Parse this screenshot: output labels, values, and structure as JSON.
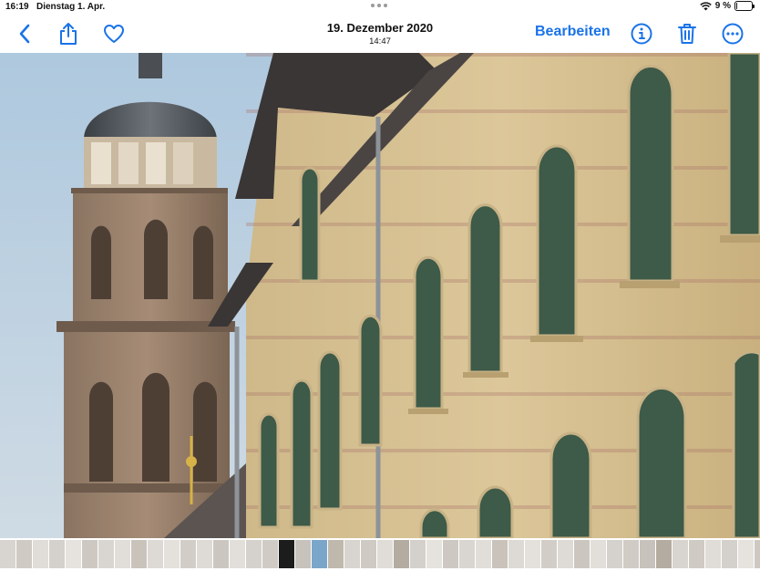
{
  "status_bar": {
    "time": "16:19",
    "date": "Dienstag 1. Apr.",
    "battery": "9 %",
    "battery_level": 0.09
  },
  "toolbar": {
    "title_date": "19. Dezember 2020",
    "title_time": "14:47",
    "edit_label": "Bearbeiten"
  },
  "icons": {
    "back": "chevron-left-icon",
    "share": "share-icon",
    "favorite": "heart-icon",
    "info": "info-icon",
    "delete": "trash-icon",
    "more": "ellipsis-circle-icon"
  },
  "colors": {
    "accent": "#1a73e8",
    "sky": "#b8cfe0",
    "brick": "#d9c48f"
  },
  "filmstrip": {
    "thumbs": [
      "#d8d4cf",
      "#cfcac4",
      "#e0ddd9",
      "#d4d0cb",
      "#e6e3df",
      "#cdc8c2",
      "#d9d5d0",
      "#e1deda",
      "#c9c3bc",
      "#ddd9d4",
      "#e4e0dc",
      "#d2cdc7",
      "#dedad5",
      "#cbc6bf",
      "#e2dfdb",
      "#d5d1cc",
      "#d0cbc5",
      "#1c1c1c",
      "#c7c2bb",
      "#7aa6c9",
      "#bfb8ad",
      "#d8d4cf",
      "#cfcac4",
      "#e0ddd9",
      "#b4aca1",
      "#d4d0cb",
      "#e6e3df",
      "#cdc8c2",
      "#d9d5d0",
      "#e1deda",
      "#c9c3bc",
      "#ddd9d4",
      "#e4e0dc",
      "#d2cdc7",
      "#dedad5",
      "#cbc6bf",
      "#e2dfdb",
      "#d5d1cc",
      "#d0cbc5",
      "#c7c2bb",
      "#b4aca1",
      "#d8d4cf",
      "#cfcac4",
      "#e0ddd9",
      "#d4d0cb",
      "#e6e3df",
      "#cdc8c2",
      "#d9d5d0",
      "#e1deda",
      "#c9c3bc",
      "#ddd9d4",
      "#e4e0dc",
      "#d2cdc7",
      "#dedad5",
      "#cbc6bf",
      "#e2dfdb",
      "#d5d1cc",
      "#d0cbc5",
      "#c7c2bb",
      "#b4aca1",
      "#d8d4cf",
      "#cfcac4",
      "#e0ddd9",
      "#d4d0cb",
      "#e6e3df",
      "#cdc8c2",
      "#d9d5d0",
      "#e1deda",
      "#c9c3bc",
      "#ddd9d4",
      "#e4e0dc",
      "#d2cdc7",
      "#dedad5",
      "#cbc6bf",
      "#e2dfdb",
      "#d5d1cc",
      "#d0cbc5",
      "#c7c2bb",
      "#b4aca1",
      "#d8d4cf",
      "#cfcac4",
      "#e0ddd9",
      "#d4d0cb",
      "#e6e3df",
      "#cdc8c2",
      "#d9d5d0",
      "#e1deda",
      "#c9c3bc",
      "#ddd9d4",
      "#e4e0dc"
    ]
  }
}
